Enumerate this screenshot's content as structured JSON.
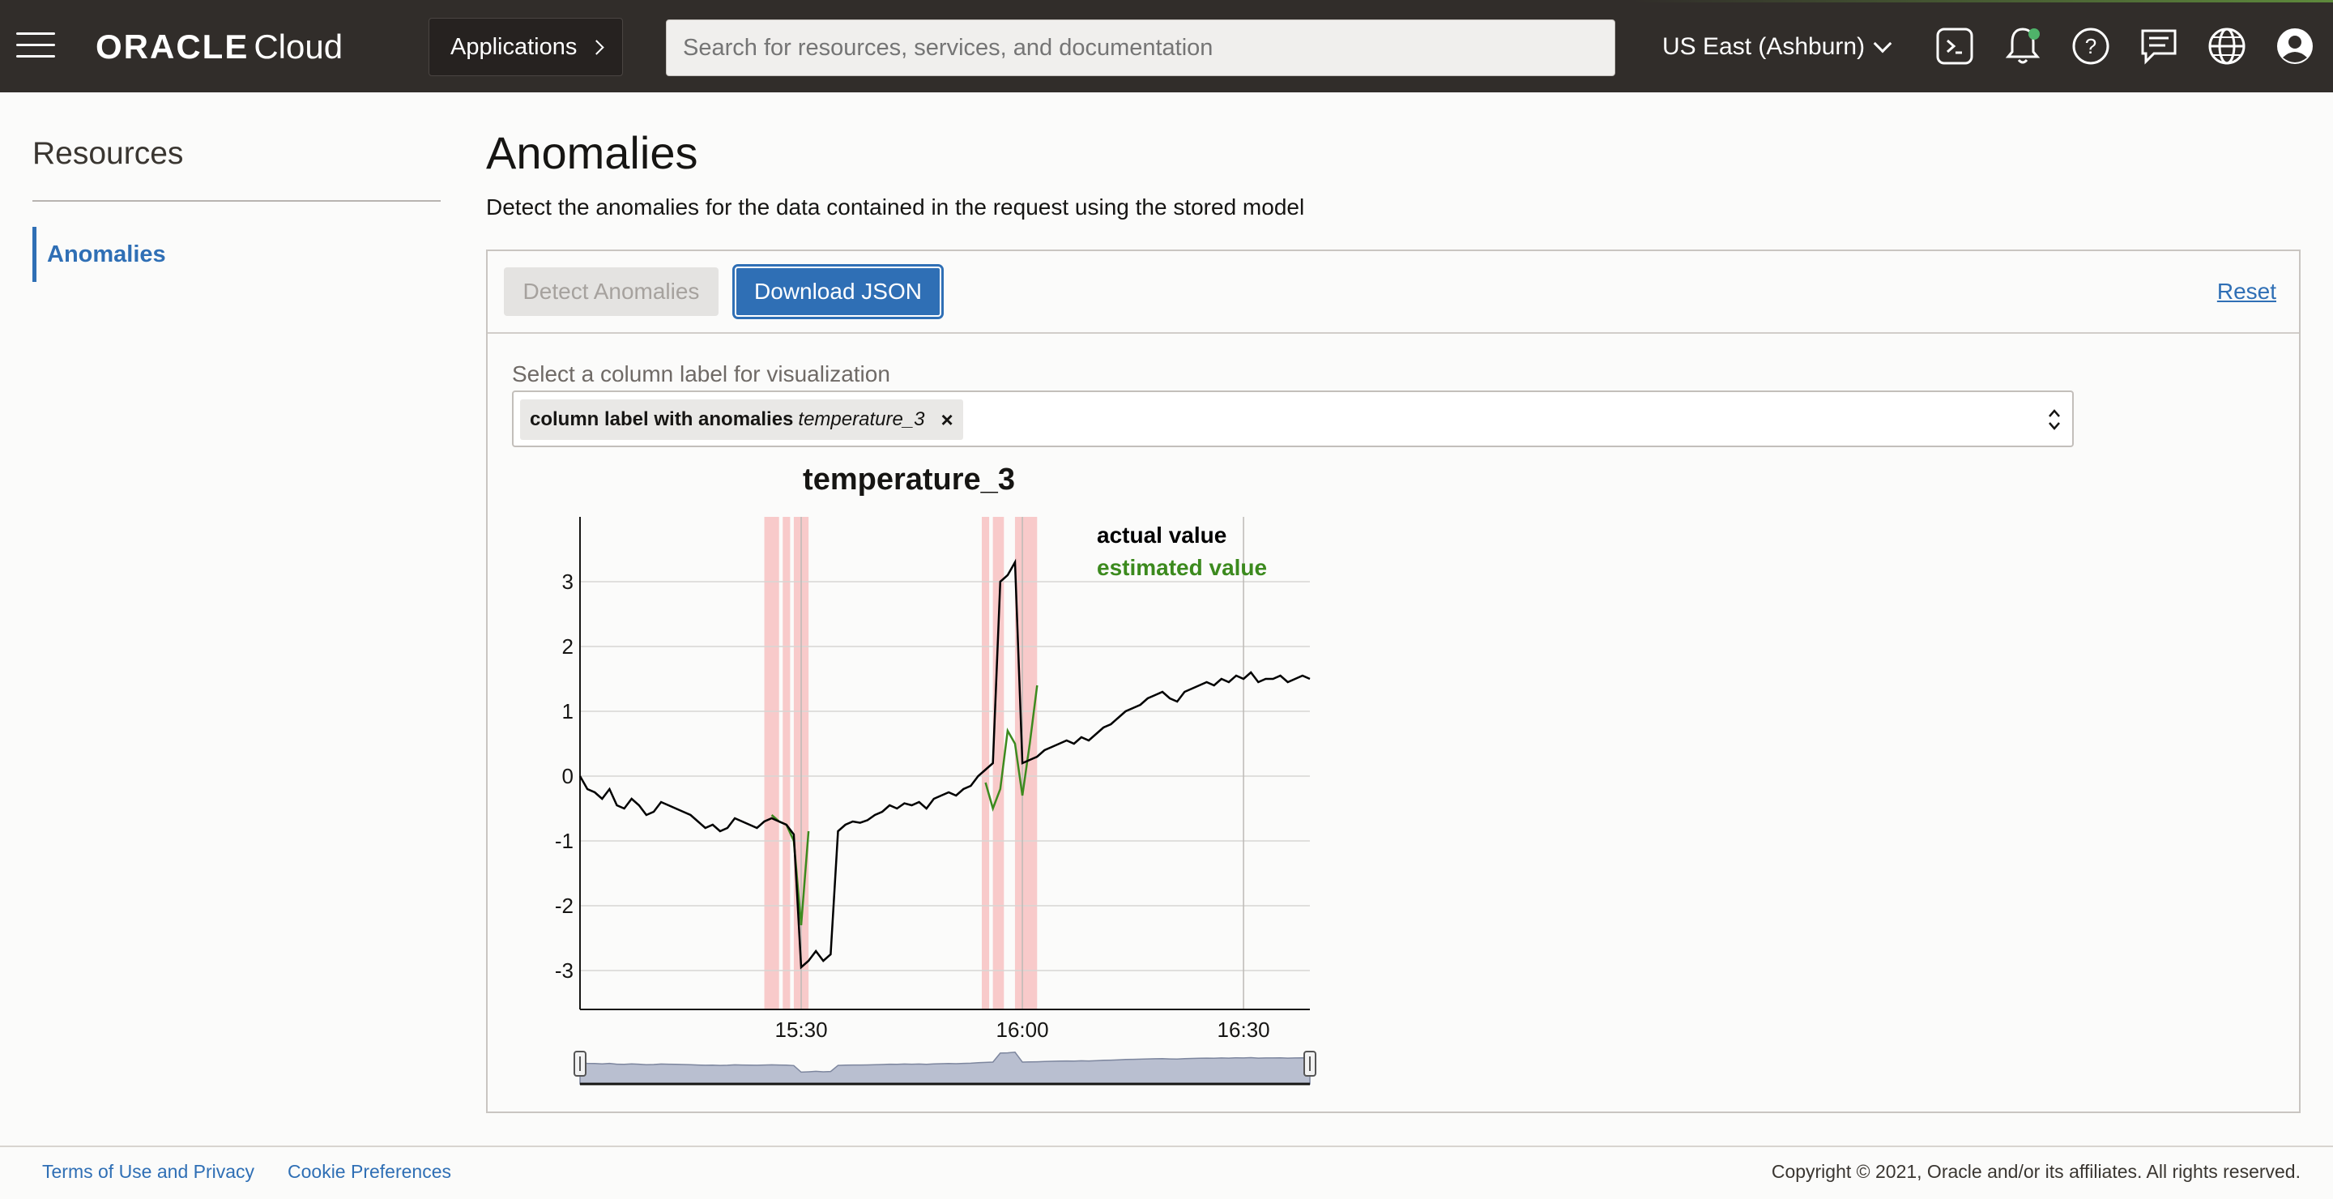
{
  "header": {
    "brand_oracle": "ORACLE",
    "brand_cloud": "Cloud",
    "apps_label": "Applications",
    "search_placeholder": "Search for resources, services, and documentation",
    "region": "US East (Ashburn)",
    "icons": [
      "menu-icon",
      "cloud-shell-icon",
      "notification-bell-icon",
      "help-icon",
      "chat-icon",
      "language-globe-icon",
      "user-profile-icon"
    ],
    "notification_dot_color": "#4fb36a"
  },
  "sidebar": {
    "title": "Resources",
    "items": [
      {
        "label": "Anomalies",
        "active": true
      }
    ]
  },
  "main": {
    "title": "Anomalies",
    "description": "Detect the anomalies for the data contained in the request using the stored model",
    "toolbar": {
      "detect_label": "Detect Anomalies",
      "download_label": "Download JSON",
      "reset_label": "Reset"
    },
    "column_select": {
      "label": "Select a column label for visualization",
      "chip_prefix": "column label with anomalies",
      "chip_value": "temperature_3",
      "chip_remove": "×"
    }
  },
  "chart_data": {
    "type": "line",
    "title": "temperature_3",
    "xlabel": "",
    "ylabel": "",
    "x_ticks": [
      "15:30",
      "16:00",
      "16:30"
    ],
    "y_ticks": [
      3,
      2,
      1,
      0,
      -1,
      -2,
      -3
    ],
    "ylim": [
      -3.6,
      4.0
    ],
    "grid": true,
    "legend_placement": "top-right",
    "colors": {
      "actual": "#000000",
      "estimated": "#3c8a1e",
      "anomaly_band": "#f5a3a3"
    },
    "series": [
      {
        "name": "actual value",
        "x": [
          "15:00",
          "15:01",
          "15:02",
          "15:03",
          "15:04",
          "15:05",
          "15:06",
          "15:07",
          "15:08",
          "15:09",
          "15:10",
          "15:11",
          "15:12",
          "15:13",
          "15:14",
          "15:15",
          "15:16",
          "15:17",
          "15:18",
          "15:19",
          "15:20",
          "15:21",
          "15:22",
          "15:23",
          "15:24",
          "15:25",
          "15:26",
          "15:27",
          "15:28",
          "15:29",
          "15:30",
          "15:31",
          "15:32",
          "15:33",
          "15:34",
          "15:35",
          "15:36",
          "15:37",
          "15:38",
          "15:39",
          "15:40",
          "15:41",
          "15:42",
          "15:43",
          "15:44",
          "15:45",
          "15:46",
          "15:47",
          "15:48",
          "15:49",
          "15:50",
          "15:51",
          "15:52",
          "15:53",
          "15:54",
          "15:55",
          "15:56",
          "15:57",
          "15:58",
          "15:59",
          "16:00",
          "16:01",
          "16:02",
          "16:03",
          "16:04",
          "16:05",
          "16:06",
          "16:07",
          "16:08",
          "16:09",
          "16:10",
          "16:11",
          "16:12",
          "16:13",
          "16:14",
          "16:15",
          "16:16",
          "16:17",
          "16:18",
          "16:19",
          "16:20",
          "16:21",
          "16:22",
          "16:23",
          "16:24",
          "16:25",
          "16:26",
          "16:27",
          "16:28",
          "16:29",
          "16:30",
          "16:31",
          "16:32",
          "16:33",
          "16:34",
          "16:35",
          "16:36",
          "16:37",
          "16:38",
          "16:39"
        ],
        "y": [
          0,
          -0.2,
          -0.25,
          -0.35,
          -0.2,
          -0.45,
          -0.5,
          -0.35,
          -0.45,
          -0.6,
          -0.55,
          -0.4,
          -0.45,
          -0.5,
          -0.55,
          -0.6,
          -0.7,
          -0.8,
          -0.75,
          -0.85,
          -0.8,
          -0.65,
          -0.7,
          -0.75,
          -0.8,
          -0.7,
          -0.65,
          -0.7,
          -0.75,
          -0.9,
          -2.95,
          -2.85,
          -2.7,
          -2.85,
          -2.75,
          -0.85,
          -0.75,
          -0.7,
          -0.72,
          -0.68,
          -0.6,
          -0.55,
          -0.45,
          -0.5,
          -0.42,
          -0.45,
          -0.4,
          -0.5,
          -0.35,
          -0.3,
          -0.25,
          -0.3,
          -0.2,
          -0.15,
          0.0,
          0.1,
          0.2,
          3.0,
          3.1,
          3.3,
          0.2,
          0.25,
          0.3,
          0.4,
          0.45,
          0.5,
          0.55,
          0.5,
          0.6,
          0.55,
          0.65,
          0.75,
          0.8,
          0.9,
          1.0,
          1.05,
          1.1,
          1.2,
          1.25,
          1.3,
          1.2,
          1.15,
          1.3,
          1.35,
          1.4,
          1.45,
          1.4,
          1.5,
          1.45,
          1.55,
          1.5,
          1.6,
          1.45,
          1.5,
          1.5,
          1.55,
          1.45,
          1.5,
          1.55,
          1.5
        ]
      },
      {
        "name": "estimated value",
        "x": [
          "15:26",
          "15:27",
          "15:28",
          "15:29",
          "15:30",
          "15:31",
          "15:55",
          "15:56",
          "15:57",
          "15:58",
          "15:59",
          "16:00",
          "16:01",
          "16:02"
        ],
        "y": [
          -0.6,
          -0.7,
          -0.75,
          -1.0,
          -2.3,
          -0.85,
          -0.1,
          -0.5,
          -0.2,
          0.7,
          0.5,
          -0.3,
          0.5,
          1.4
        ]
      }
    ],
    "anomaly_windows": [
      [
        "15:25",
        "15:27"
      ],
      [
        "15:27.5",
        "15:28.5"
      ],
      [
        "15:29",
        "15:31"
      ],
      [
        "15:54.5",
        "15:55.5"
      ],
      [
        "15:56",
        "15:57.5"
      ],
      [
        "15:59",
        "16:02"
      ]
    ]
  },
  "footer": {
    "links": [
      "Terms of Use and Privacy",
      "Cookie Preferences"
    ],
    "copyright": "Copyright © 2021, Oracle and/or its affiliates. All rights reserved."
  }
}
